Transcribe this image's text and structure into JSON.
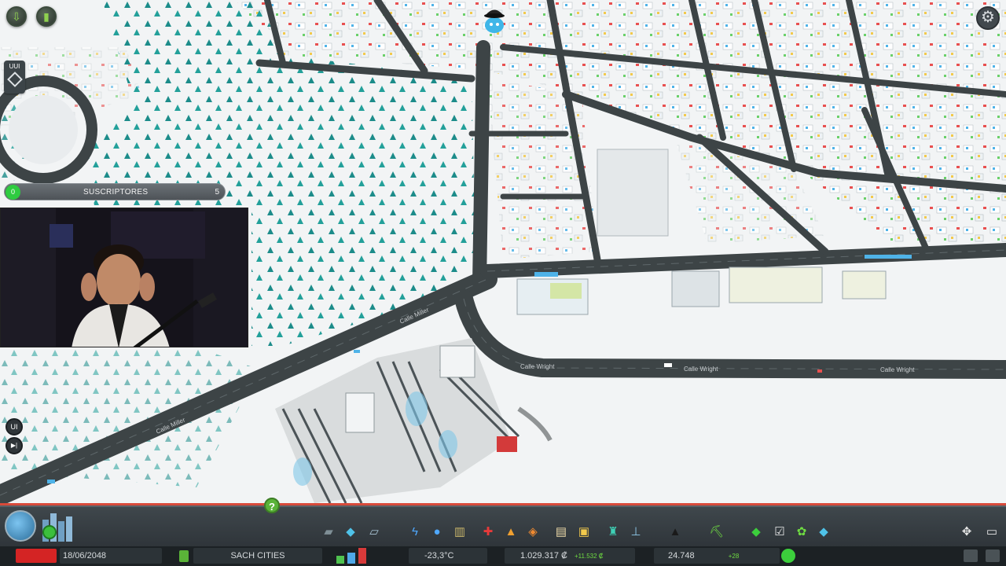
{
  "game": {
    "city_name": "SACH CITIES",
    "date": "18/06/2048",
    "temperature": "-23,3°C",
    "money": "1.029.317 ₡",
    "income": "+11.532 ₡",
    "population": "24.748",
    "population_delta": "+28"
  },
  "overlay": {
    "ui_toggle_label": "UUI",
    "subs_label": "SUSCRIPTORES",
    "subs_count": "0",
    "subs_goal": "5",
    "side_button_ui": "UI",
    "side_button_play": "▶|"
  },
  "map": {
    "street_labels": [
      "Calle Wright",
      "Calle Wright",
      "Calle Wright",
      "Calle Miller",
      "Calle Miller"
    ]
  },
  "help": {
    "label": "?"
  },
  "toolbar": {
    "icons": [
      "roads-icon",
      "zoning-icon",
      "districts-icon",
      "electricity-icon",
      "water-icon",
      "garbage-icon",
      "healthcare-icon",
      "fire-icon",
      "police-icon",
      "education-icon",
      "public-transport-icon",
      "decoration-icon",
      "monuments-icon",
      "parks-icon",
      "disasters-icon",
      "landscaping-icon",
      "unique-buildings-icon",
      "policies-icon",
      "economy-icon",
      "info-views-icon"
    ]
  },
  "colors": {
    "accent": "#8fd14f",
    "money_positive": "#6fdc42",
    "snow": "#f3f5f6",
    "road": "#3d4446"
  }
}
